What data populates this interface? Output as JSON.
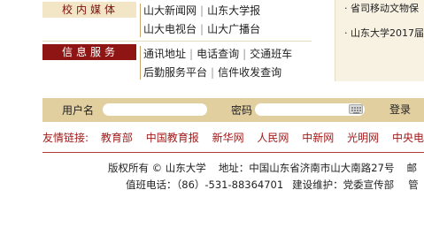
{
  "media": {
    "tab_label": "校内媒体",
    "row1": [
      "山大新闻网",
      "山东大学报"
    ],
    "row2": [
      "山大电视台",
      "山大广播台"
    ]
  },
  "info": {
    "tab_label": "信息服务",
    "row1": [
      "通讯地址",
      "电话查询",
      "交通班车"
    ],
    "row2": [
      "后勤服务平台",
      "信件收发查询"
    ]
  },
  "news": {
    "items": [
      "· 省司移动文物保",
      "· 山东大学2017届"
    ]
  },
  "login": {
    "username_label": "用户名",
    "password_label": "密码",
    "login_button": "登录"
  },
  "friend_links": {
    "label": "友情链接:",
    "items": [
      "教育部",
      "中国教育报",
      "新华网",
      "人民网",
      "中新网",
      "光明网",
      "中央电视"
    ]
  },
  "footer": {
    "copyright": "版权所有 © 山东大学",
    "address": "地址：中国山东省济南市山大南路27号",
    "trailing_1": "邮",
    "phone": "值班电话：（86）-531-88364701",
    "maintainer": "建设维护：党委宣传部",
    "trailing_2": "管"
  },
  "colors": {
    "brand_red": "#8f1414",
    "login_bar": "#e2cfa0",
    "link_red": "#a21a1a"
  }
}
